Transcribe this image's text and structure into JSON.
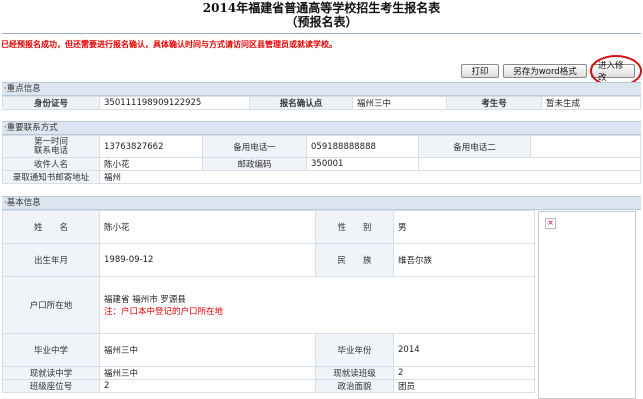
{
  "header": {
    "title": "2014年福建省普通高等学校招生考生报名表",
    "subtitle": "（预报名表）"
  },
  "notice": "已经预报名成功，但还需要进行报名确认，具体确认时间与方式请访问区县管理员或就读学校。",
  "toolbar": {
    "print_label": "打印",
    "word_label": "另存为word格式",
    "edit_label": "进入修改"
  },
  "key_info": {
    "section_title": "·重点信息",
    "id_label": "身份证号",
    "id_value": "350111198909122925",
    "confirm_site_label": "报名确认点",
    "confirm_site_value": "福州三中",
    "exam_no_label": "考生号",
    "exam_no_value": "暂未生成"
  },
  "contact": {
    "section_title": "·重要联系方式",
    "phone1_label": "第一时间\n联系电话",
    "phone1_value": "13763827662",
    "alt1_label": "备用电话一",
    "alt1_value": "059188888888",
    "alt2_label": "备用电话二",
    "alt2_value": "",
    "recipient_label": "收件人名",
    "recipient_value": "陈小花",
    "postcode_label": "邮政编码",
    "postcode_value": "350001",
    "address_label": "录取通知书邮寄地址",
    "address_value": "福州"
  },
  "basic": {
    "section_title": "·基本信息",
    "name_label": "姓　　名",
    "name_value": "陈小花",
    "gender_label": "性　　别",
    "gender_value": "男",
    "birth_label": "出生年月",
    "birth_value": "1989-09-12",
    "ethnic_label": "民　　族",
    "ethnic_value": "维吾尔族",
    "hukou_label": "户口所在地",
    "hukou_value": "福建省  福州市  罗源县",
    "hukou_note": "注：户口本中登记的户口所在地",
    "grad_school_label": "毕业中学",
    "grad_school_value": "福州三中",
    "grad_year_label": "毕业年份",
    "grad_year_value": "2014",
    "cur_school_label": "现就读中学",
    "cur_school_value": "福州三中",
    "cur_class_label": "现就读班级",
    "cur_class_value": "2",
    "seat_label": "班级座位号",
    "seat_value": "2",
    "political_label": "政治面貌",
    "political_value": "团员"
  }
}
